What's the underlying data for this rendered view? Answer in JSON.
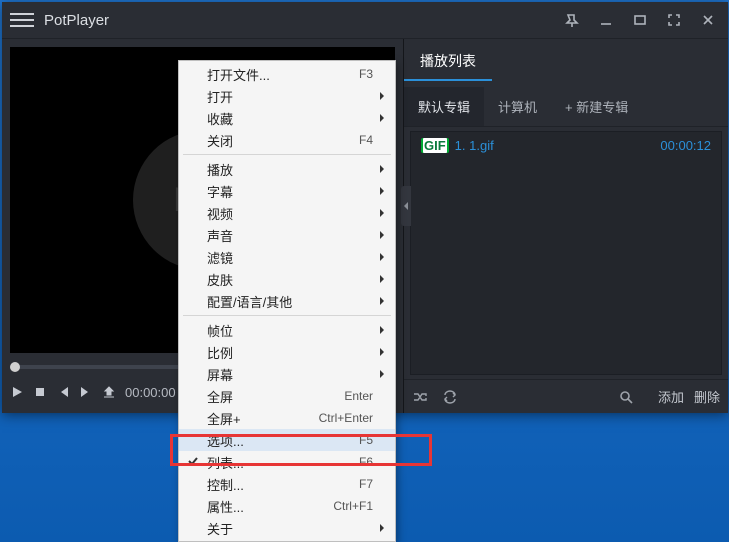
{
  "app": {
    "title": "PotPlayer"
  },
  "controls": {
    "current_time": "00:00:00",
    "duration_placeholder": " "
  },
  "playlist_panel": {
    "header_tab": "播放列表",
    "albums": [
      {
        "label": "默认专辑",
        "active": true
      },
      {
        "label": "计算机",
        "active": false
      },
      {
        "label": "+ 新建专辑",
        "active": false
      }
    ],
    "items": [
      {
        "name": "1. 1.gif",
        "duration": "00:00:12"
      }
    ],
    "footer": {
      "add_label": "添加",
      "delete_label": "删除"
    }
  },
  "video_stage": {
    "logo_text": "Pot"
  },
  "context_menu": [
    {
      "type": "item",
      "label": "打开文件...",
      "accel": "F3",
      "submenu": false
    },
    {
      "type": "item",
      "label": "打开",
      "accel": "",
      "submenu": true
    },
    {
      "type": "item",
      "label": "收藏",
      "accel": "",
      "submenu": true
    },
    {
      "type": "item",
      "label": "关闭",
      "accel": "F4",
      "submenu": false
    },
    {
      "type": "sep"
    },
    {
      "type": "item",
      "label": "播放",
      "accel": "",
      "submenu": true
    },
    {
      "type": "item",
      "label": "字幕",
      "accel": "",
      "submenu": true
    },
    {
      "type": "item",
      "label": "视频",
      "accel": "",
      "submenu": true
    },
    {
      "type": "item",
      "label": "声音",
      "accel": "",
      "submenu": true
    },
    {
      "type": "item",
      "label": "滤镜",
      "accel": "",
      "submenu": true
    },
    {
      "type": "item",
      "label": "皮肤",
      "accel": "",
      "submenu": true
    },
    {
      "type": "item",
      "label": "配置/语言/其他",
      "accel": "",
      "submenu": true
    },
    {
      "type": "sep"
    },
    {
      "type": "item",
      "label": "帧位",
      "accel": "",
      "submenu": true
    },
    {
      "type": "item",
      "label": "比例",
      "accel": "",
      "submenu": true
    },
    {
      "type": "item",
      "label": "屏幕",
      "accel": "",
      "submenu": true
    },
    {
      "type": "item",
      "label": "全屏",
      "accel": "Enter",
      "submenu": false
    },
    {
      "type": "item",
      "label": "全屏+",
      "accel": "Ctrl+Enter",
      "submenu": false
    },
    {
      "type": "item",
      "label": "选项...",
      "accel": "F5",
      "submenu": false,
      "hovered": true
    },
    {
      "type": "item",
      "label": "列表...",
      "accel": "F6",
      "submenu": false,
      "checked": true
    },
    {
      "type": "item",
      "label": "控制...",
      "accel": "F7",
      "submenu": false
    },
    {
      "type": "item",
      "label": "属性...",
      "accel": "Ctrl+F1",
      "submenu": false
    },
    {
      "type": "item",
      "label": "关于",
      "accel": "",
      "submenu": true
    }
  ]
}
